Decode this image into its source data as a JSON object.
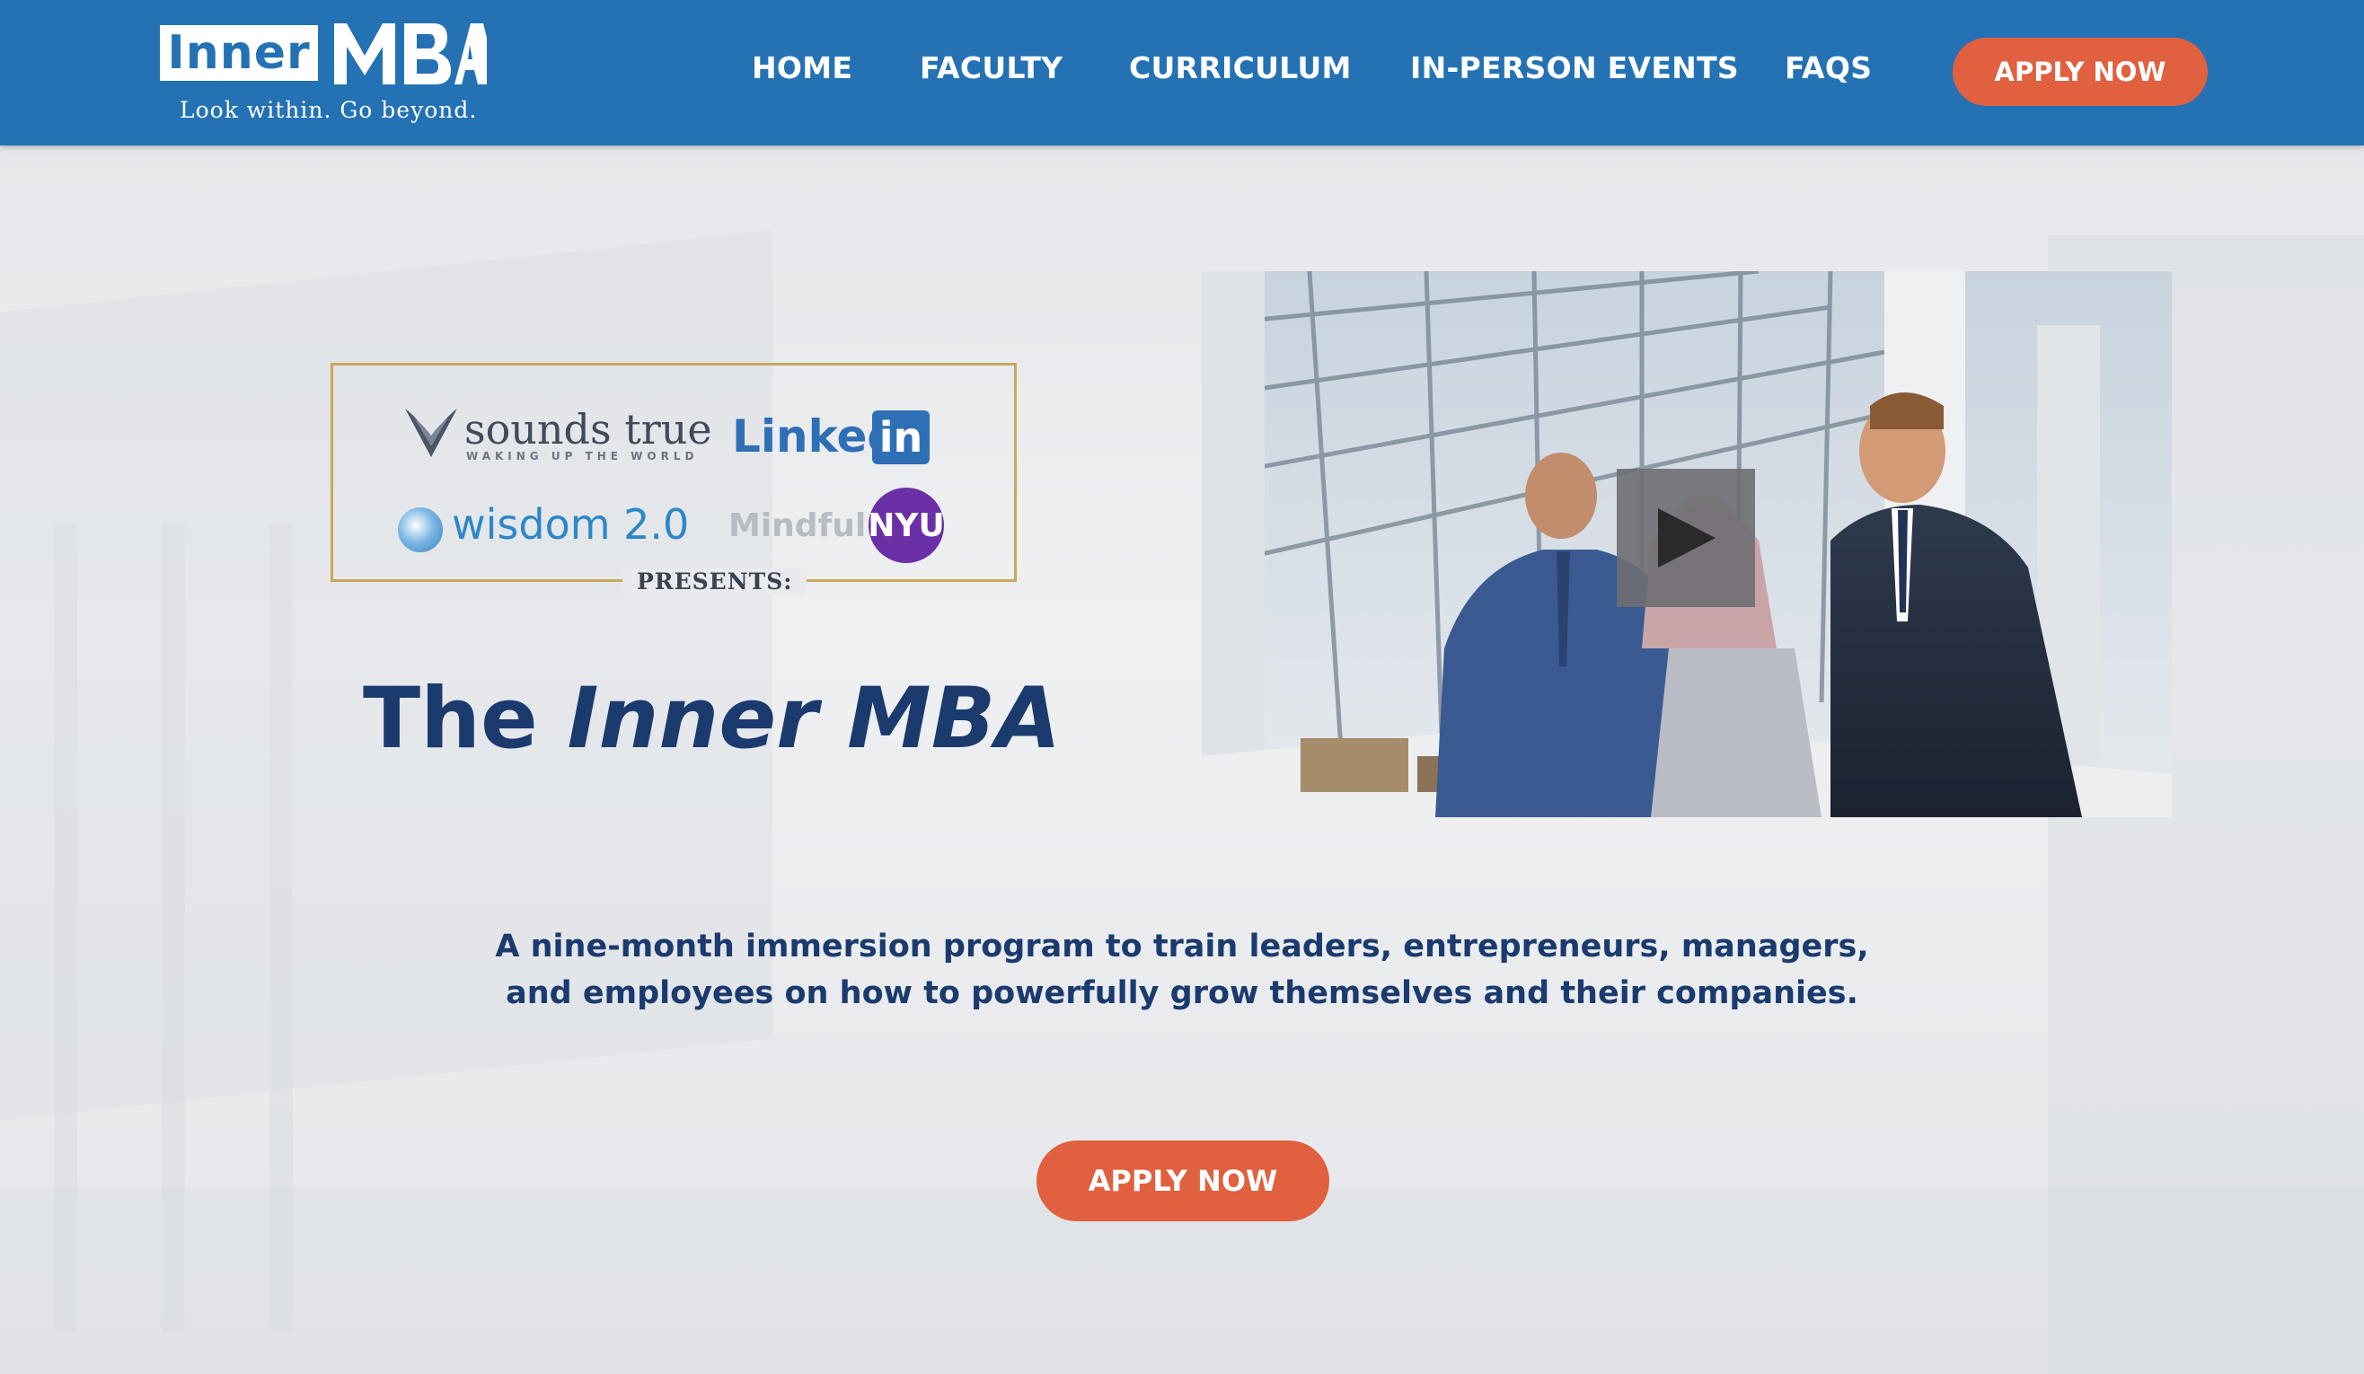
{
  "brand": {
    "logo_inner": "Inner",
    "logo_mba": "MBA",
    "tagline": "Look within. Go beyond."
  },
  "nav": {
    "items": [
      {
        "label": "HOME"
      },
      {
        "label": "FACULTY"
      },
      {
        "label": "CURRICULUM"
      },
      {
        "label": "IN-PERSON EVENTS"
      },
      {
        "label": "FAQS"
      }
    ],
    "apply_label": "APPLY NOW"
  },
  "partners": {
    "sounds_true": "sounds true",
    "sounds_true_tag": "WAKING UP THE WORLD",
    "linkedin_word": "Linked",
    "linkedin_box": "in",
    "wisdom": "wisdom 2.0",
    "mindful": "Mindful",
    "nyu": "NYU",
    "presents": "PRESENTS:"
  },
  "hero": {
    "title_prefix": "The ",
    "title_emphasis": "Inner MBA",
    "description_line1": "A nine-month immersion program to train leaders, entrepreneurs, managers,",
    "description_line2": "and employees on how to powerfully grow themselves and their companies.",
    "apply_label": "APPLY NOW"
  },
  "video": {
    "play_icon": "play-icon"
  },
  "colors": {
    "header_bg": "#2472b4",
    "accent_orange": "#e0603f",
    "title_navy": "#1b3b6e",
    "frame_gold": "#c9a85a"
  }
}
